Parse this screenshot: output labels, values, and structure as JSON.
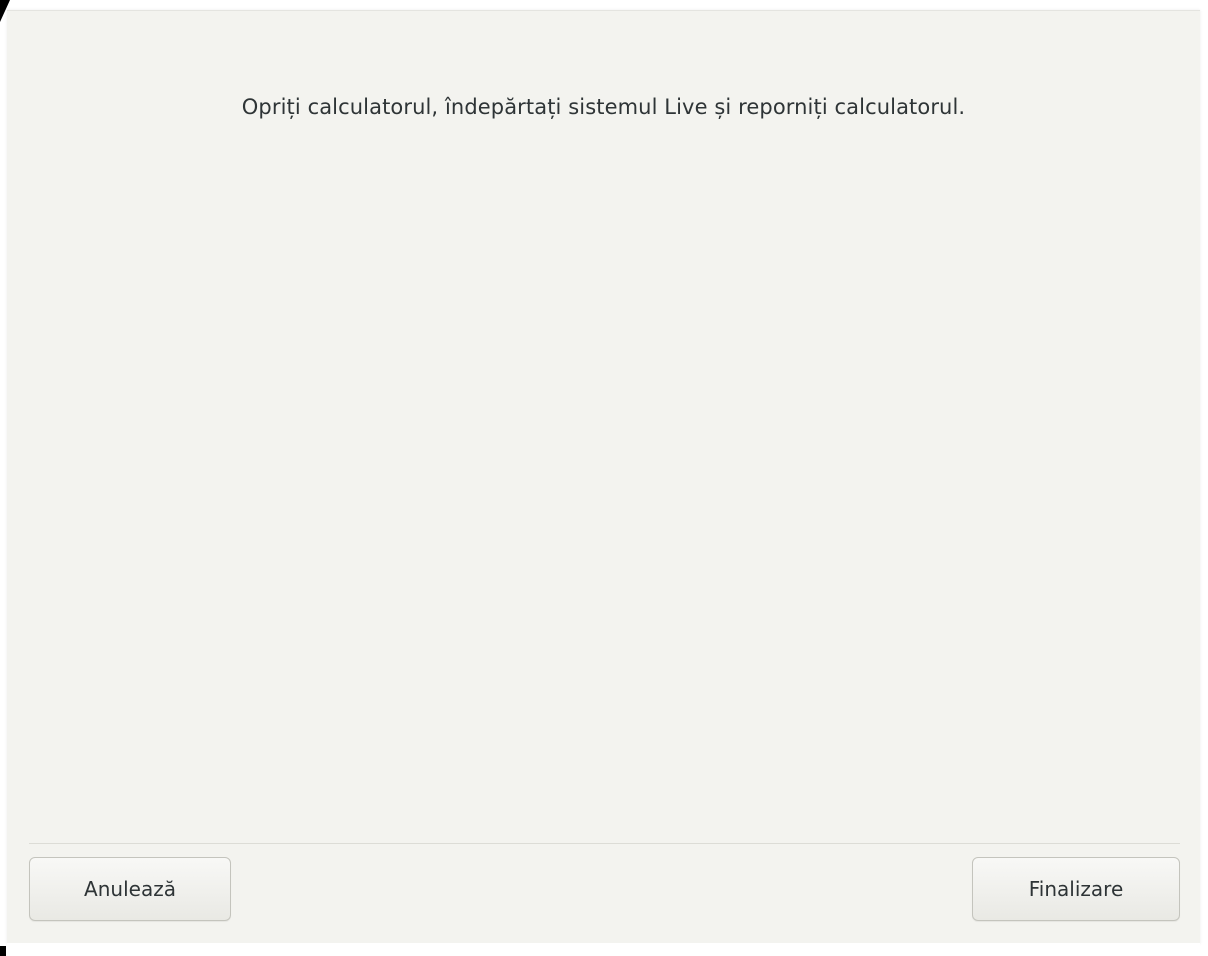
{
  "dialog": {
    "message": "Opriți calculatorul, îndepărtați sistemul Live și reporniți calculatorul."
  },
  "buttons": {
    "cancel_label": "Anulează",
    "finish_label": "Finalizare"
  },
  "colors": {
    "window_bg": "#f3f3ef",
    "text": "#2e3436",
    "separator": "#dcdcd6",
    "button_border": "#c4c4bd"
  }
}
